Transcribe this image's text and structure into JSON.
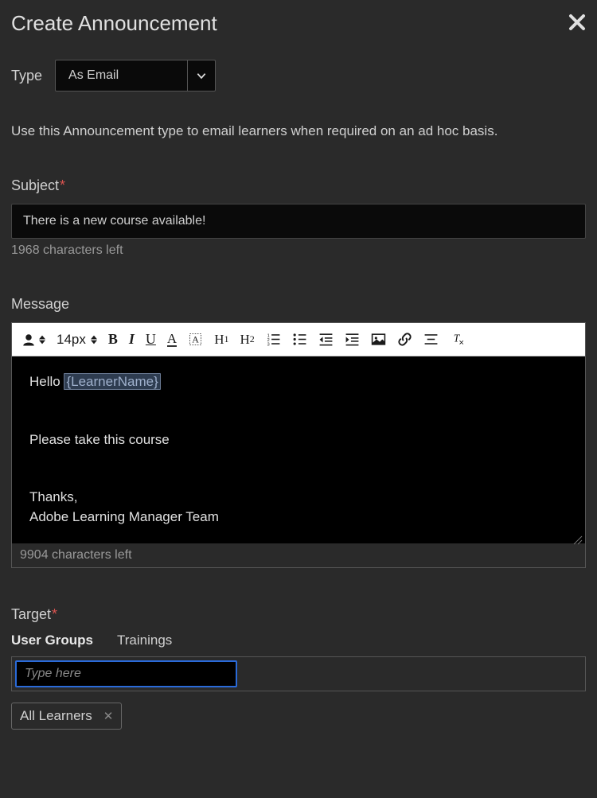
{
  "header": {
    "title": "Create Announcement"
  },
  "type": {
    "label": "Type",
    "value": "As Email"
  },
  "help_text": "Use this Announcement type to email learners when required on an ad hoc basis.",
  "subject": {
    "label": "Subject",
    "value": "There is a new course available!",
    "counter": "1968 characters left"
  },
  "message": {
    "label": "Message",
    "font_size": "14px",
    "greeting": "Hello ",
    "token": "{LearnerName}",
    "line2": "Please take this course",
    "line3": "Thanks,",
    "line4": "Adobe Learning Manager Team",
    "counter": "9904 characters left"
  },
  "target": {
    "label": "Target",
    "tabs": {
      "user_groups": "User Groups",
      "trainings": "Trainings"
    },
    "placeholder": "Type here",
    "chip": "All Learners"
  }
}
